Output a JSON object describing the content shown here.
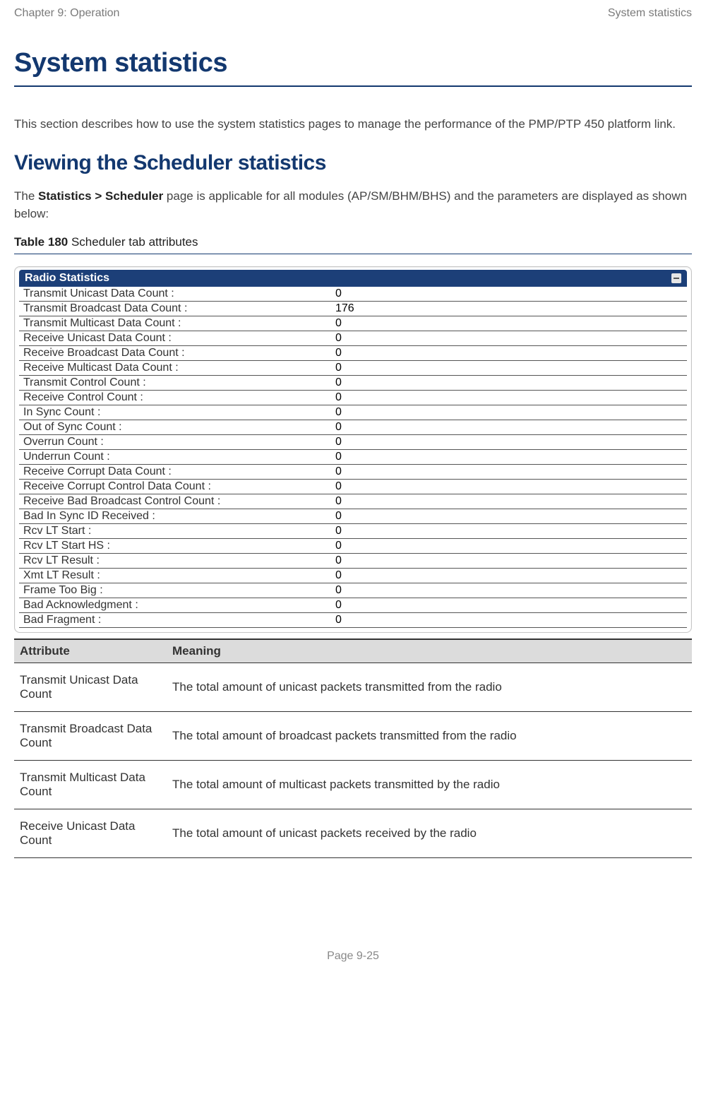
{
  "header": {
    "left": "Chapter 9:  Operation",
    "right": "System statistics"
  },
  "h1": "System statistics",
  "intro": "This section describes how to use the system statistics pages to manage the performance of the PMP/PTP 450 platform link.",
  "h2": "Viewing the Scheduler statistics",
  "para_prefix": "The ",
  "para_bold": "Statistics > Scheduler",
  "para_suffix": " page is applicable for all modules (AP/SM/BHM/BHS) and the parameters are displayed as shown below:",
  "caption_bold": "Table 180",
  "caption_rest": " Scheduler tab attributes",
  "panel_title": "Radio Statistics",
  "stats_rows": [
    {
      "label": "Transmit Unicast Data Count :",
      "value": "0"
    },
    {
      "label": "Transmit Broadcast Data Count :",
      "value": "176"
    },
    {
      "label": "Transmit Multicast Data Count :",
      "value": "0"
    },
    {
      "label": "Receive Unicast Data Count :",
      "value": "0"
    },
    {
      "label": "Receive Broadcast Data Count :",
      "value": "0"
    },
    {
      "label": "Receive Multicast Data Count :",
      "value": "0"
    },
    {
      "label": "Transmit Control Count :",
      "value": "0"
    },
    {
      "label": "Receive Control Count :",
      "value": "0"
    },
    {
      "label": "In Sync Count :",
      "value": "0"
    },
    {
      "label": "Out of Sync Count :",
      "value": "0"
    },
    {
      "label": "Overrun Count :",
      "value": "0"
    },
    {
      "label": "Underrun Count :",
      "value": "0"
    },
    {
      "label": "Receive Corrupt Data Count :",
      "value": "0"
    },
    {
      "label": "Receive Corrupt Control Data Count :",
      "value": "0"
    },
    {
      "label": "Receive Bad Broadcast Control Count :",
      "value": "0"
    },
    {
      "label": "Bad In Sync ID Received :",
      "value": "0"
    },
    {
      "label": "Rcv LT Start :",
      "value": "0"
    },
    {
      "label": "Rcv LT Start HS :",
      "value": "0"
    },
    {
      "label": "Rcv LT Result :",
      "value": "0"
    },
    {
      "label": "Xmt LT Result :",
      "value": "0"
    },
    {
      "label": "Frame Too Big :",
      "value": "0"
    },
    {
      "label": "Bad Acknowledgment :",
      "value": "0"
    },
    {
      "label": "Bad Fragment :",
      "value": "0"
    }
  ],
  "attr_headers": {
    "attr": "Attribute",
    "meaning": "Meaning"
  },
  "attr_rows": [
    {
      "attr": "Transmit Unicast Data Count",
      "meaning": "The total amount of unicast packets transmitted from the radio"
    },
    {
      "attr": "Transmit Broadcast Data Count",
      "meaning": "The total amount of broadcast packets transmitted from the radio"
    },
    {
      "attr": "Transmit Multicast Data Count",
      "meaning": "The total amount of multicast packets transmitted by the radio"
    },
    {
      "attr": "Receive Unicast Data Count",
      "meaning": "The total amount of unicast packets received by the radio"
    }
  ],
  "footer": "Page 9-25"
}
